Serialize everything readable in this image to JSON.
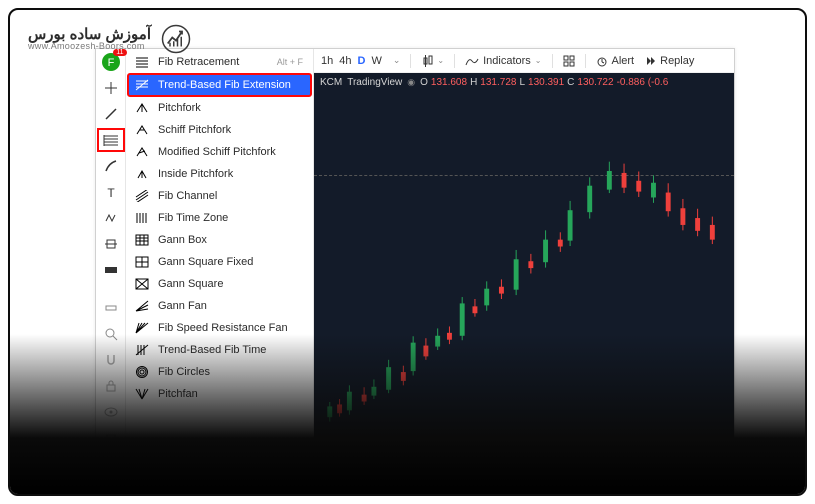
{
  "branding": {
    "title_ar": "آموزش ساده بورس",
    "url": "www.Amoozesh-Boors.com"
  },
  "vtoolbar_badge": "11",
  "top_tool": {
    "label": "Fib Retracement",
    "shortcut": "Alt + F"
  },
  "tools": [
    {
      "label": "Trend-Based Fib Extension",
      "selected": true
    },
    {
      "label": "Pitchfork"
    },
    {
      "label": "Schiff Pitchfork"
    },
    {
      "label": "Modified Schiff Pitchfork"
    },
    {
      "label": "Inside Pitchfork"
    },
    {
      "label": "Fib Channel"
    },
    {
      "label": "Fib Time Zone"
    },
    {
      "label": "Gann Box"
    },
    {
      "label": "Gann Square Fixed"
    },
    {
      "label": "Gann Square"
    },
    {
      "label": "Gann Fan"
    },
    {
      "label": "Fib Speed Resistance Fan"
    },
    {
      "label": "Trend-Based Fib Time"
    },
    {
      "label": "Fib Circles"
    },
    {
      "label": "Pitchfan"
    }
  ],
  "timeframes": {
    "items": [
      "1h",
      "4h",
      "D",
      "W"
    ],
    "active": "D"
  },
  "topbar": {
    "candles_down": "⌄",
    "indicators": "Indicators",
    "alert": "Alert",
    "replay": "Replay"
  },
  "ticker": {
    "source": "KCM",
    "provider": "TradingView",
    "o": "131.608",
    "h": "131.728",
    "l": "130.391",
    "c": "130.722",
    "chg": "-0.886 (-0.6"
  }
}
